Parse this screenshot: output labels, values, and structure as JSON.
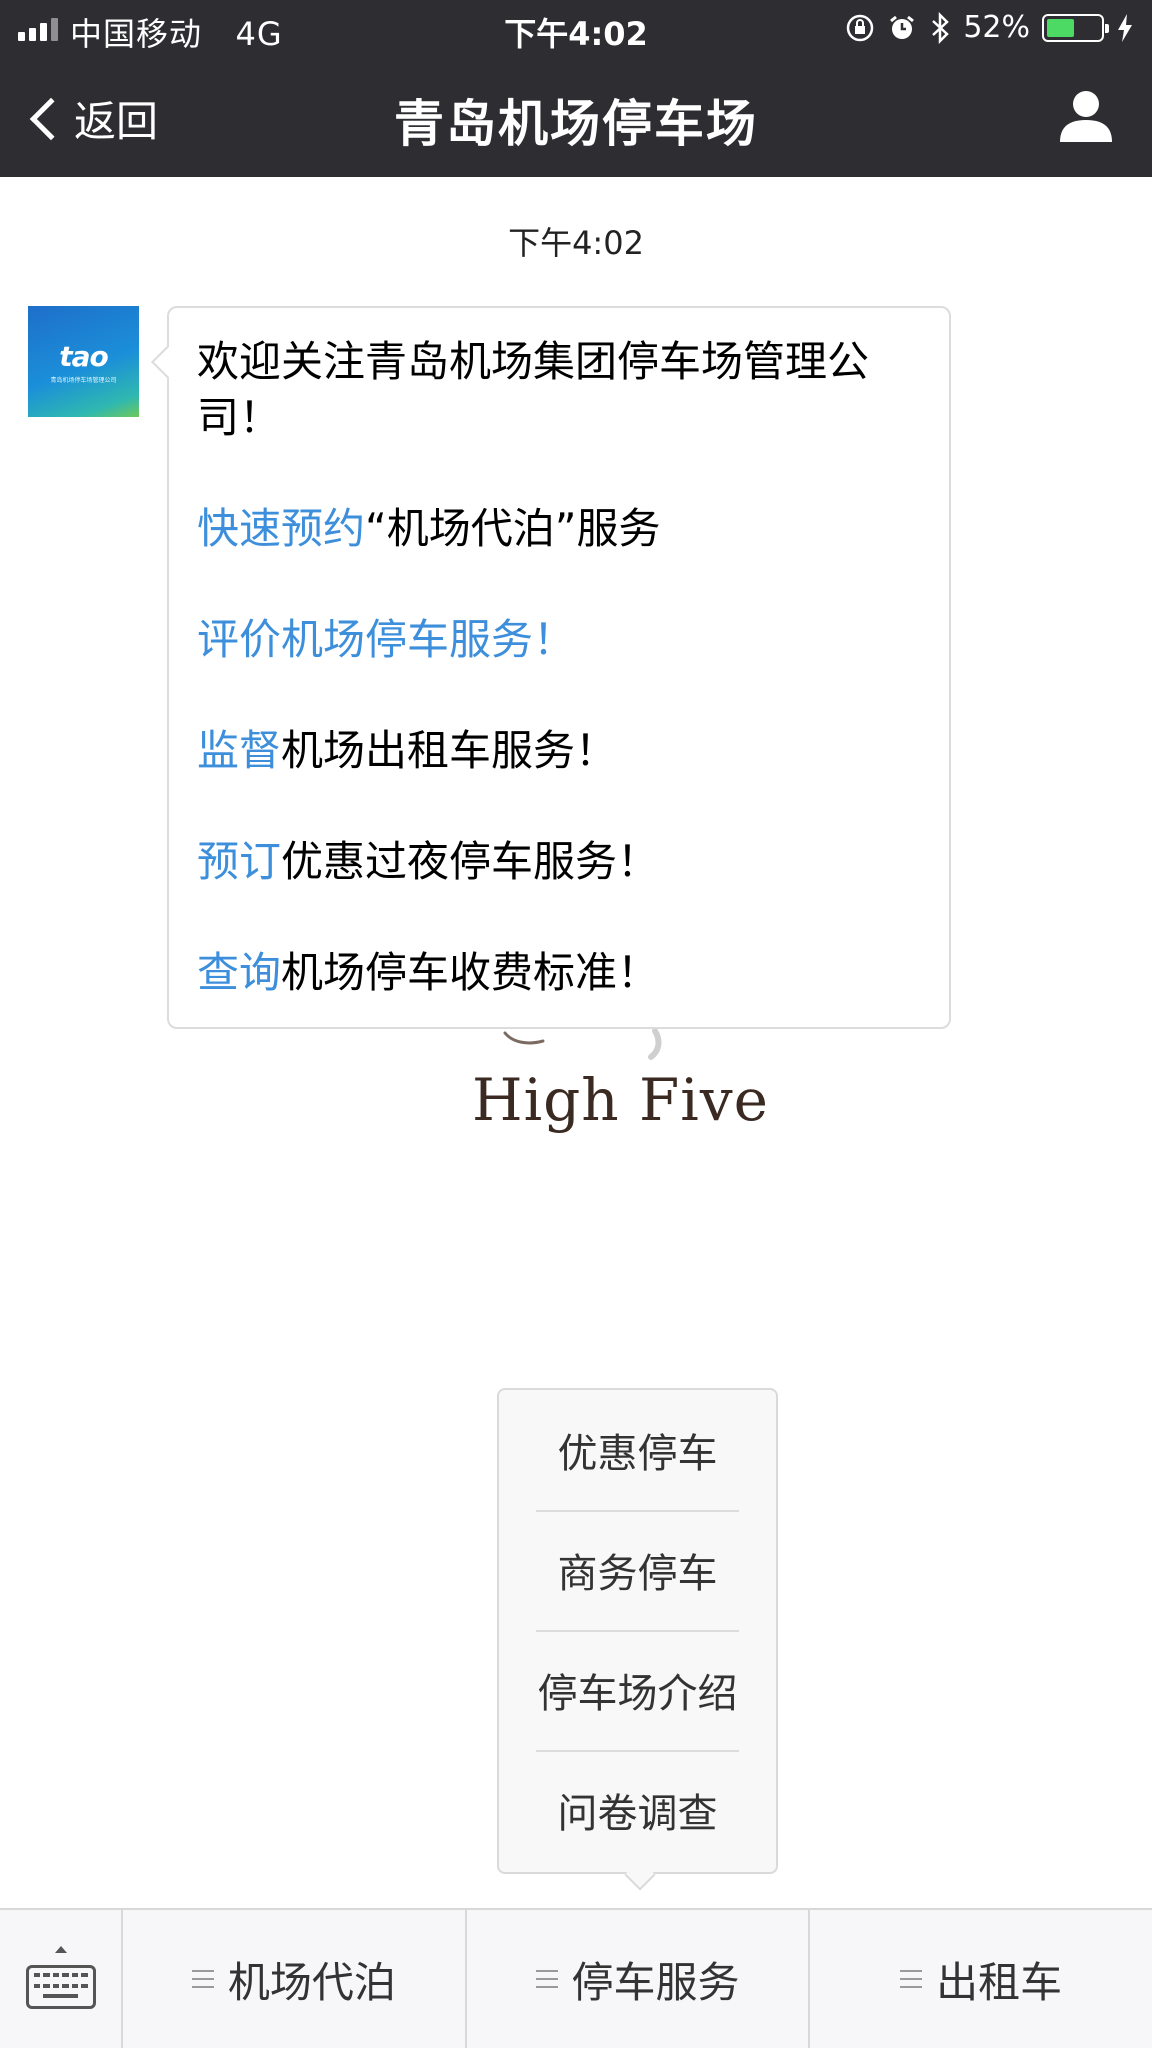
{
  "status_bar": {
    "carrier": "中国移动",
    "network": "4G",
    "time": "下午4:02",
    "battery_percent": "52%",
    "battery_level": 0.52,
    "icons": [
      "signal-icon",
      "orientation-lock-icon",
      "alarm-icon",
      "bluetooth-icon",
      "battery-icon",
      "charging-icon"
    ]
  },
  "nav": {
    "back_label": "返回",
    "title": "青岛机场停车场",
    "profile_icon": "profile-icon"
  },
  "chat": {
    "timestamp": "下午4:02",
    "avatar": {
      "logo_text": "tao",
      "sub_text": "青岛机场停车场管理公司"
    },
    "message": {
      "welcome": "欢迎关注青岛机场集团停车场管理公司！",
      "lines": [
        {
          "link": "快速预约",
          "text": "“机场代泊”服务"
        },
        {
          "link": "评价机场停车服务！",
          "text": ""
        },
        {
          "link": "监督",
          "text": "机场出租车服务！"
        },
        {
          "link": "预订",
          "text": "优惠过夜停车服务！"
        },
        {
          "link": "查询",
          "text": "机场停车收费标准！"
        }
      ]
    },
    "sticker_text": "High Five"
  },
  "popup_menu": {
    "items": [
      "优惠停车",
      "商务停车",
      "停车场介绍",
      "问卷调查"
    ]
  },
  "bottom_menu": {
    "keyboard_icon": "keyboard-icon",
    "items": [
      "机场代泊",
      "停车服务",
      "出租车"
    ]
  },
  "colors": {
    "topbar": "#2e2d32",
    "link": "#3d8fdb",
    "battery": "#4cd964"
  }
}
